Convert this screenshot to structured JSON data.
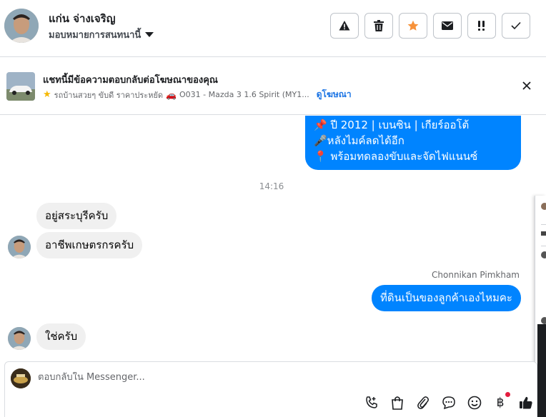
{
  "header": {
    "contact_name": "แก่น จ่างเจริญ",
    "assign_label": "มอบหมายการสนทนานี้",
    "actions": [
      {
        "name": "report-button",
        "icon": "warning-icon"
      },
      {
        "name": "delete-button",
        "icon": "trash-icon"
      },
      {
        "name": "star-button",
        "icon": "star-icon",
        "color": "#f7923a"
      },
      {
        "name": "mark-unread-button",
        "icon": "envelope-icon"
      },
      {
        "name": "follow-up-button",
        "icon": "priority-icon"
      },
      {
        "name": "mark-done-button",
        "icon": "checkmark-icon"
      }
    ]
  },
  "ad_banner": {
    "title": "แชทนี้มีข้อความตอบกลับต่อโฆษณาของคุณ",
    "page_name": "รถบ้านสวยๆ ขับดี ราคาประหยัด",
    "ad_name": "O031 - Mazda 3 1.6 Spirit (MY1...",
    "link_label": "ดูโฆษณา"
  },
  "chat": {
    "outgoing_listing": [
      "📌 ปี 2012 | เบนซิน | เกียร์ออโต้",
      "🎤หลังไมค์ลดได้อีก",
      "📍 พร้อมทดลองขับและจัดไฟแนนซ์"
    ],
    "timestamp": "14:16",
    "messages": [
      {
        "from": "contact",
        "text": "อยู่สระบุรีครับ"
      },
      {
        "from": "contact",
        "text": "อาชีพเกษตรกรครับ"
      },
      {
        "from": "page",
        "sender": "Chonnikan Pimkham",
        "text": "ที่ดินเป็นของลูกค้าเองไหมคะ"
      },
      {
        "from": "contact",
        "text": "ใช่ครับ"
      }
    ]
  },
  "composer": {
    "placeholder": "ตอบกลับใน Messenger...",
    "tools": [
      "call-icon",
      "bag-icon",
      "paperclip-icon",
      "saved-reply-icon",
      "emoji-icon",
      "baht-icon",
      "thumbs-up-icon"
    ],
    "baht_symbol": "฿"
  },
  "colors": {
    "outgoing_bubble": "#0084ff",
    "incoming_bubble": "#f0f0f0",
    "link": "#1b74e4",
    "star_accent": "#f7923a"
  }
}
